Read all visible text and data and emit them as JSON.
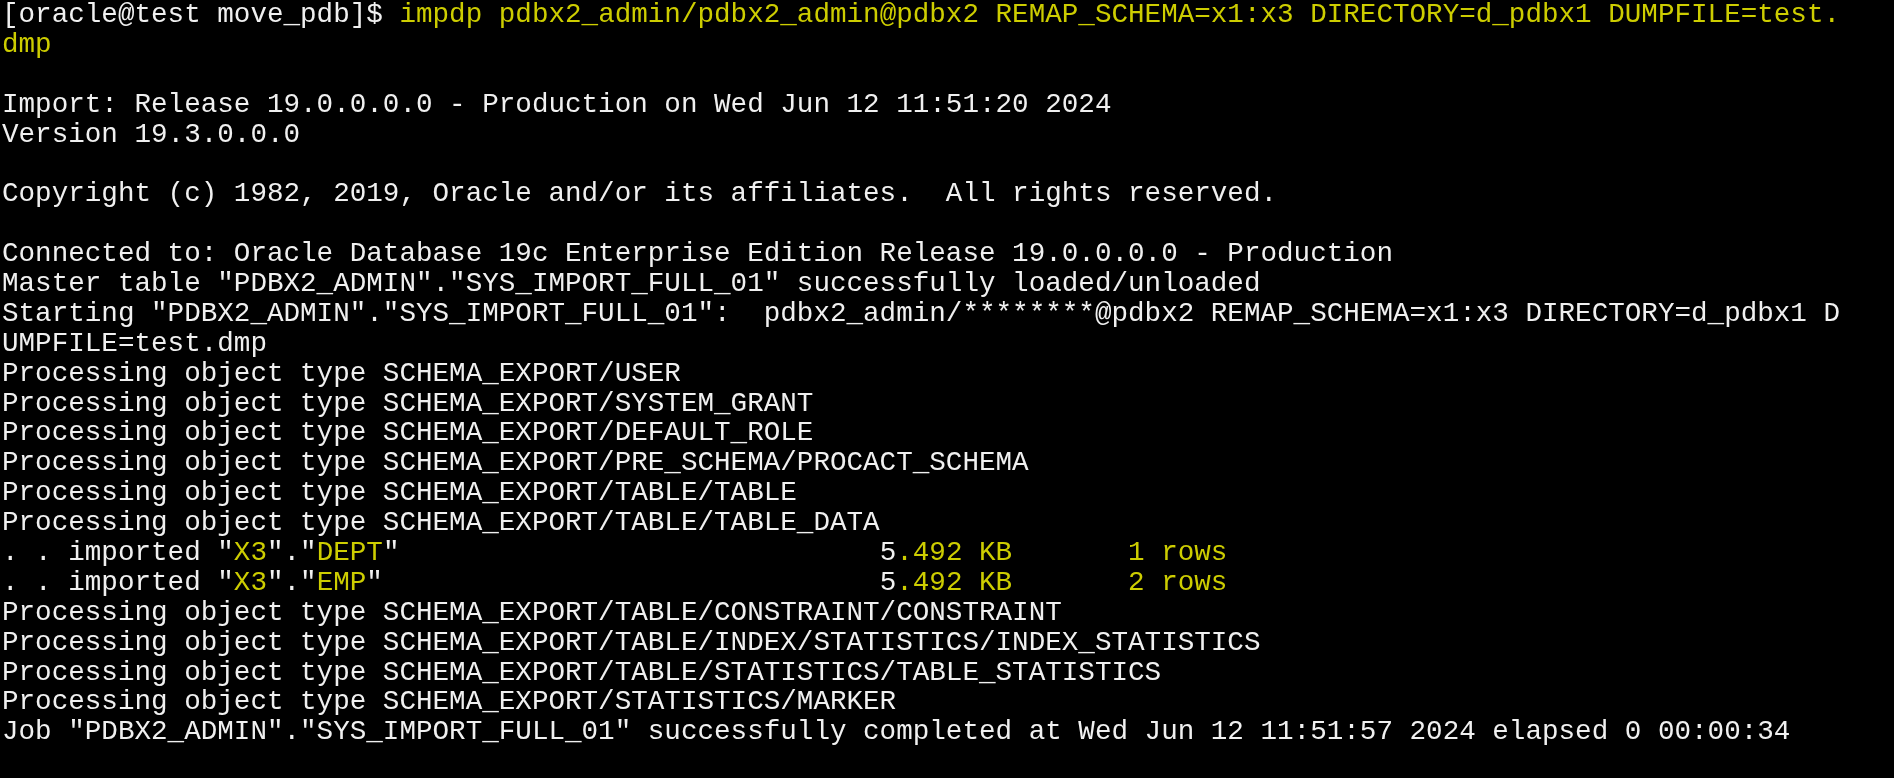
{
  "terminal": {
    "lines": [
      {
        "segments": [
          {
            "text": "[oracle@test move_pdb]$ ",
            "highlight": false
          },
          {
            "text": "impdp pdbx2_admin/pdbx2_admin@pdbx2 REMAP_SCHEMA=x1:x3 DIRECTORY=d_pdbx1 DUMPFILE=test.",
            "highlight": true
          }
        ]
      },
      {
        "segments": [
          {
            "text": "dmp",
            "highlight": true
          }
        ]
      },
      {
        "gap_before": true,
        "segments": [
          {
            "text": "Import: Release 19.0.0.0.0 - Production on Wed Jun 12 11:51:20 2024",
            "highlight": false
          }
        ]
      },
      {
        "segments": [
          {
            "text": "Version 19.3.0.0.0",
            "highlight": false
          }
        ]
      },
      {
        "gap_before": true,
        "segments": [
          {
            "text": "Copyright (c) 1982, 2019, Oracle and/or its affiliates.  All rights reserved.",
            "highlight": false
          }
        ]
      },
      {
        "gap_before": true,
        "segments": [
          {
            "text": "Connected to: Oracle Database 19c Enterprise Edition Release 19.0.0.0.0 - Production",
            "highlight": false
          }
        ]
      },
      {
        "segments": [
          {
            "text": "Master table \"PDBX2_ADMIN\".\"SYS_IMPORT_FULL_01\" successfully loaded/unloaded",
            "highlight": false
          }
        ]
      },
      {
        "segments": [
          {
            "text": "Starting \"PDBX2_ADMIN\".\"SYS_IMPORT_FULL_01\":  pdbx2_admin/********@pdbx2 REMAP_SCHEMA=x1:x3 DIRECTORY=d_pdbx1 D",
            "highlight": false
          }
        ]
      },
      {
        "segments": [
          {
            "text": "UMPFILE=test.dmp",
            "highlight": false
          }
        ]
      },
      {
        "segments": [
          {
            "text": "Processing object type SCHEMA_EXPORT/USER",
            "highlight": false
          }
        ]
      },
      {
        "segments": [
          {
            "text": "Processing object type SCHEMA_EXPORT/SYSTEM_GRANT",
            "highlight": false
          }
        ]
      },
      {
        "segments": [
          {
            "text": "Processing object type SCHEMA_EXPORT/DEFAULT_ROLE",
            "highlight": false
          }
        ]
      },
      {
        "segments": [
          {
            "text": "Processing object type SCHEMA_EXPORT/PRE_SCHEMA/PROCACT_SCHEMA",
            "highlight": false
          }
        ]
      },
      {
        "segments": [
          {
            "text": "Processing object type SCHEMA_EXPORT/TABLE/TABLE",
            "highlight": false
          }
        ]
      },
      {
        "segments": [
          {
            "text": "Processing object type SCHEMA_EXPORT/TABLE/TABLE_DATA",
            "highlight": false
          }
        ]
      },
      {
        "segments": [
          {
            "text": ". . imported \"",
            "highlight": false
          },
          {
            "text": "X3",
            "highlight": true
          },
          {
            "text": "\".\"",
            "highlight": false
          },
          {
            "text": "DEPT",
            "highlight": true
          },
          {
            "text": "\"                             5",
            "highlight": false
          },
          {
            "text": ".492 KB       1 rows",
            "highlight": true
          }
        ]
      },
      {
        "segments": [
          {
            "text": ". . imported \"",
            "highlight": false
          },
          {
            "text": "X3",
            "highlight": true
          },
          {
            "text": "\".\"",
            "highlight": false
          },
          {
            "text": "EMP",
            "highlight": true
          },
          {
            "text": "\"                              5",
            "highlight": false
          },
          {
            "text": ".492 KB       2 rows",
            "highlight": true
          }
        ]
      },
      {
        "segments": [
          {
            "text": "Processing object type SCHEMA_EXPORT/TABLE/CONSTRAINT/CONSTRAINT",
            "highlight": false
          }
        ]
      },
      {
        "segments": [
          {
            "text": "Processing object type SCHEMA_EXPORT/TABLE/INDEX/STATISTICS/INDEX_STATISTICS",
            "highlight": false
          }
        ]
      },
      {
        "segments": [
          {
            "text": "Processing object type SCHEMA_EXPORT/TABLE/STATISTICS/TABLE_STATISTICS",
            "highlight": false
          }
        ]
      },
      {
        "segments": [
          {
            "text": "Processing object type SCHEMA_EXPORT/STATISTICS/MARKER",
            "highlight": false
          }
        ]
      },
      {
        "segments": [
          {
            "text": "Job \"PDBX2_ADMIN\".\"SYS_IMPORT_FULL_01\" successfully completed at Wed Jun 12 11:51:57 2024 elapsed 0 00:00:34",
            "highlight": false
          }
        ]
      }
    ]
  }
}
